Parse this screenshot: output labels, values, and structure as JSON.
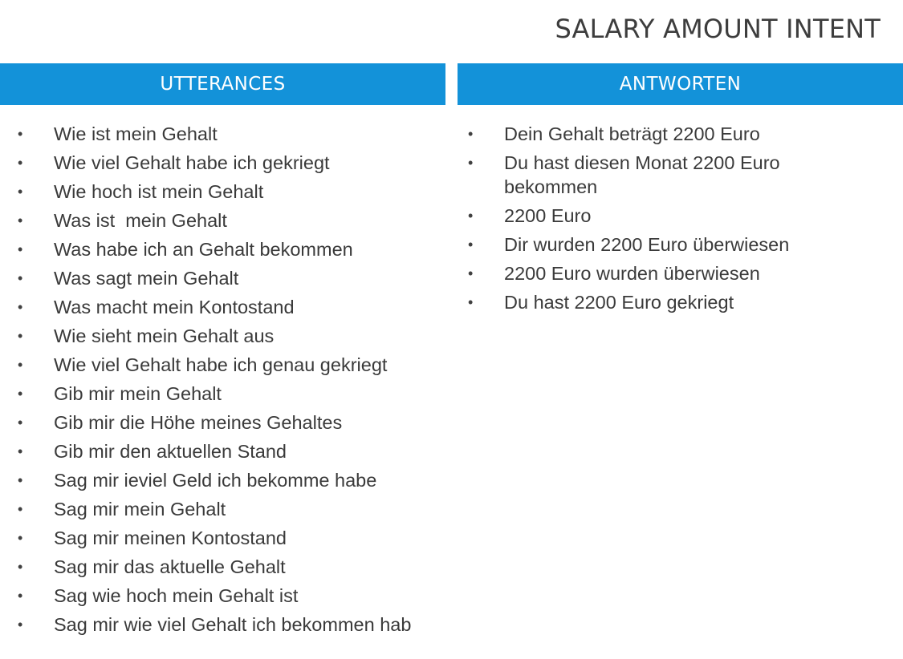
{
  "slide": {
    "title": "SALARY AMOUNT INTENT"
  },
  "columns": {
    "utterances": {
      "header": "UTTERANCES",
      "items": [
        "Wie ist mein Gehalt",
        "Wie viel Gehalt habe ich gekriegt",
        "Wie hoch ist mein Gehalt",
        "Was ist  mein Gehalt",
        "Was habe ich an Gehalt bekommen",
        "Was sagt mein Gehalt",
        "Was macht mein Kontostand",
        "Wie sieht mein Gehalt aus",
        "Wie viel Gehalt habe ich genau gekriegt",
        "Gib mir mein Gehalt",
        "Gib mir die Höhe meines Gehaltes",
        "Gib mir den aktuellen Stand",
        "Sag mir ieviel Geld ich bekomme habe",
        "Sag mir mein Gehalt",
        "Sag mir meinen Kontostand",
        "Sag mir das aktuelle Gehalt",
        "Sag wie hoch mein Gehalt ist",
        "Sag mir wie viel Gehalt ich bekommen hab"
      ]
    },
    "antworten": {
      "header": "ANTWORTEN",
      "items": [
        "Dein Gehalt beträgt 2200 Euro",
        "Du hast diesen Monat 2200 Euro bekommen",
        "2200 Euro",
        "Dir wurden 2200 Euro überwiesen",
        "2200 Euro wurden überwiesen",
        "Du hast 2200 Euro gekriegt"
      ]
    }
  },
  "bullet_symbol": "•",
  "colors": {
    "header_background": "#1392d9",
    "header_text": "#ffffff",
    "body_text": "#3a3a3a"
  }
}
